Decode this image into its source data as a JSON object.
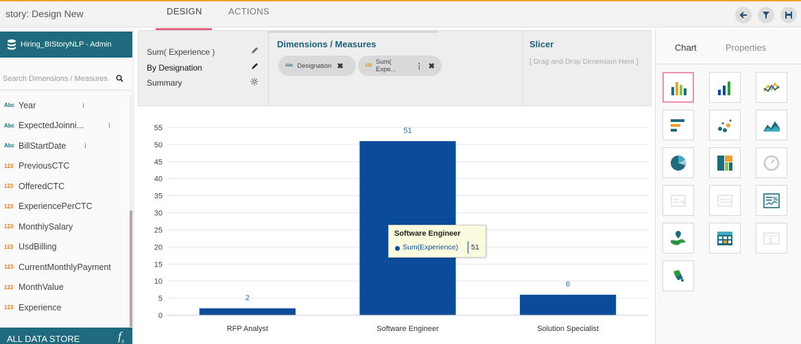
{
  "header": {
    "story_title": "story: Design New",
    "tabs": [
      {
        "label": "DESIGN"
      },
      {
        "label": "ACTIONS"
      }
    ],
    "buttons": [
      "back-arrow-icon",
      "filter-icon",
      "save-icon"
    ],
    "accent": "#e9607e"
  },
  "sidebar": {
    "datastore_name": "Hiring_BIStoryNLP - Admin",
    "search_placeholder": "Search Dimensions / Measures",
    "fields": [
      {
        "type": "Abc",
        "name": "Year",
        "info": "i"
      },
      {
        "type": "Abc",
        "name": "ExpectedJoinni...",
        "info": "i"
      },
      {
        "type": "Abc",
        "name": "BillStartDate",
        "info": "i"
      },
      {
        "type": "123",
        "name": "PreviousCTC"
      },
      {
        "type": "123",
        "name": "OfferedCTC"
      },
      {
        "type": "123",
        "name": "ExperiencePerCTC"
      },
      {
        "type": "123",
        "name": "MonthlySalary"
      },
      {
        "type": "123",
        "name": "UsdBilling"
      },
      {
        "type": "123",
        "name": "CurrentMonthlyPayment"
      },
      {
        "type": "123",
        "name": "MonthValue"
      },
      {
        "type": "123",
        "name": "Experience"
      }
    ],
    "footer_label": "ALL DATA STORE",
    "footer_icon": "f",
    "footer_icon_sub": "x",
    "header_color": "#1f6a7c"
  },
  "config": {
    "measure_label": "Sum( Experience )",
    "dimension_label": "By Designation",
    "summary_label": "Summary",
    "dm_title": "Dimensions / Measures",
    "chips": [
      {
        "type": "Abc",
        "label": "Designation"
      },
      {
        "type": "123",
        "label": "Sum( Expe..."
      }
    ],
    "slicer_title": "Slicer",
    "slicer_hint": "[ Drag and Drop Dimension Here ]"
  },
  "chart_data": {
    "type": "bar",
    "categories": [
      "RFP Analyst",
      "Software Engineer",
      "Solution Specialist"
    ],
    "series": [
      {
        "name": "Sum(Experience)",
        "values": [
          2,
          51,
          6
        ],
        "color": "#0a4b9a"
      }
    ],
    "ylim": [
      0,
      55
    ],
    "yticks": [
      0,
      5,
      10,
      15,
      20,
      25,
      30,
      35,
      40,
      45,
      50,
      55
    ],
    "grid": true,
    "data_labels": [
      "2",
      "51",
      "6"
    ],
    "tooltip": {
      "title": "Software Engineer",
      "series": "Sum(Experience)",
      "value": "51"
    }
  },
  "right_panel": {
    "tabs": [
      {
        "label": "Chart"
      },
      {
        "label": "Properties"
      }
    ],
    "chart_types": [
      "grouped-bar-chart-icon",
      "bar-chart-icon",
      "line-chart-icon",
      "horizontal-bar-chart-icon",
      "scatter-chart-icon",
      "area-chart-icon",
      "pie-chart-icon",
      "treemap-chart-icon",
      "gauge-chart-icon",
      "kpi-chart-icon",
      "progress-chart-icon",
      "trend-chart-icon",
      "map-chart-icon",
      "data-grid-icon",
      "summary-table-icon",
      "hierarchy-chart-icon"
    ],
    "selected_chart": "grouped-bar-chart-icon"
  }
}
